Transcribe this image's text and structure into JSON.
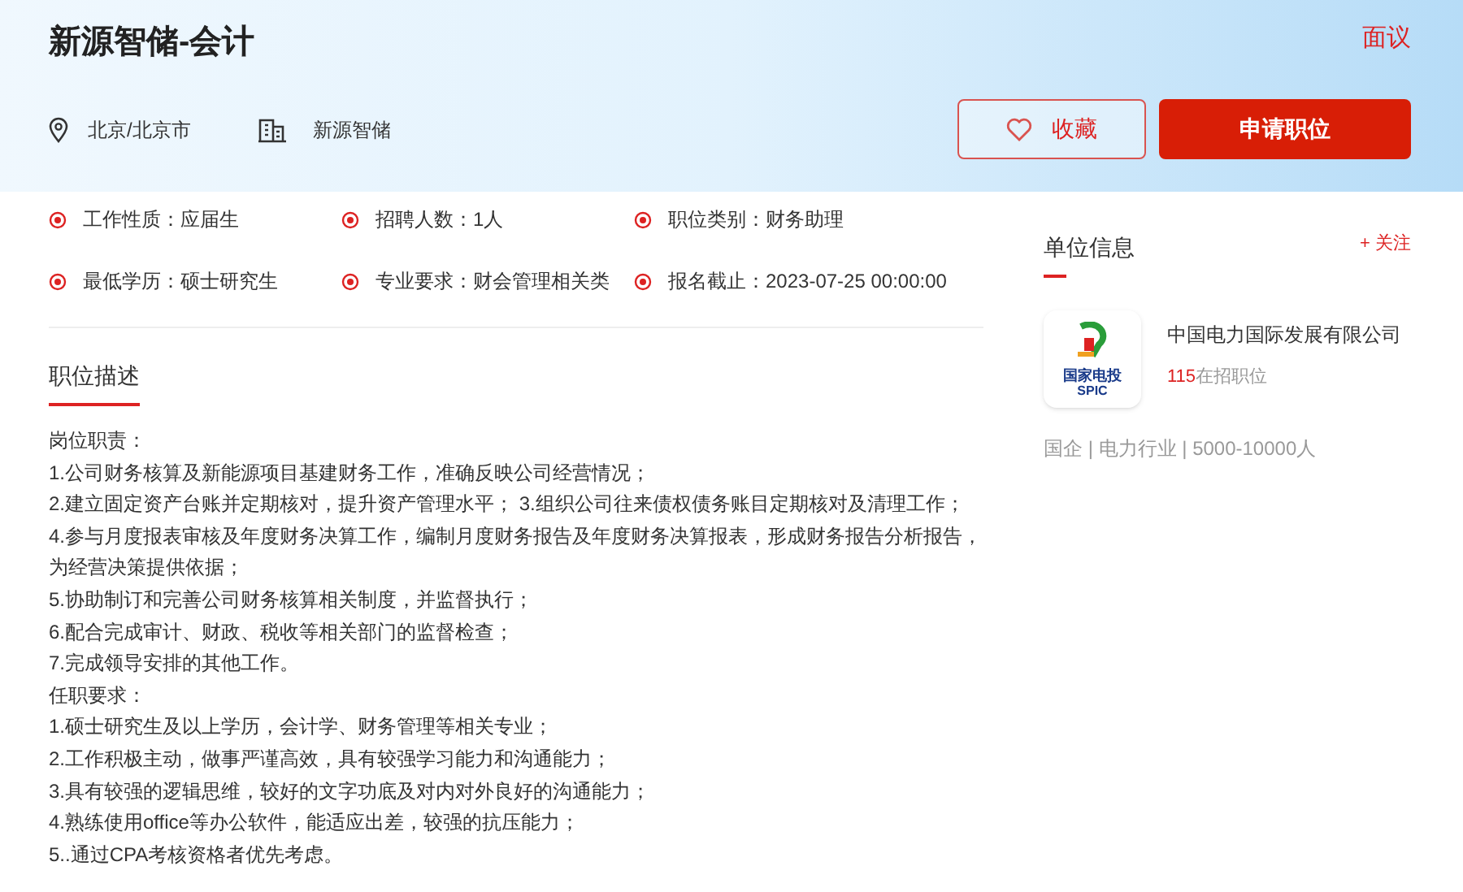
{
  "header": {
    "title": "新源智储-会计",
    "salary": "面议",
    "location": "北京/北京市",
    "company": "新源智储",
    "buttons": [
      {
        "kind": "favorite",
        "label": "收藏"
      },
      {
        "kind": "apply",
        "label": "申请职位"
      }
    ]
  },
  "facts": [
    {
      "label": "工作性质：",
      "value": "应届生"
    },
    {
      "label": "招聘人数：",
      "value": "1人"
    },
    {
      "label": "职位类别：",
      "value": "财务助理"
    },
    {
      "label": "最低学历：",
      "value": "硕士研究生"
    },
    {
      "label": "专业要求：",
      "value": "财会管理相关类"
    },
    {
      "label": "报名截止：",
      "value": "2023-07-25 00:00:00"
    }
  ],
  "description": {
    "tab": "职位描述",
    "lines": [
      "岗位职责：",
      "1.公司财务核算及新能源项目基建财务工作，准确反映公司经营情况；",
      "2.建立固定资产台账并定期核对，提升资产管理水平； 3.组织公司往来债权债务账目定期核对及清理工作；",
      "4.参与月度报表审核及年度财务决算工作，编制月度财务报告及年度财务决算报表，形成财务报告分析报告，为经营决策提供依据；",
      "5.协助制订和完善公司财务核算相关制度，并监督执行；",
      "6.配合完成审计、财政、税收等相关部门的监督检查；",
      "7.完成领导安排的其他工作。",
      "任职要求：",
      "1.硕士研究生及以上学历，会计学、财务管理等相关专业；",
      "2.工作积极主动，做事严谨高效，具有较强学习能力和沟通能力；",
      "3.具有较强的逻辑思维，较好的文字功底及对内对外良好的沟通能力；",
      "4.熟练使用office等办公软件，能适应出差，较强的抗压能力；",
      "5..通过CPA考核资格者优先考虑。"
    ]
  },
  "company_panel": {
    "title": "单位信息",
    "follow": "+ 关注",
    "name": "中国电力国际发展有限公司",
    "jobs_count": "115",
    "jobs_label": "在招职位",
    "logo_text": "国家电投",
    "logo_subtext": "SPIC",
    "meta": "国企 | 电力行业 | 5000-10000人"
  }
}
